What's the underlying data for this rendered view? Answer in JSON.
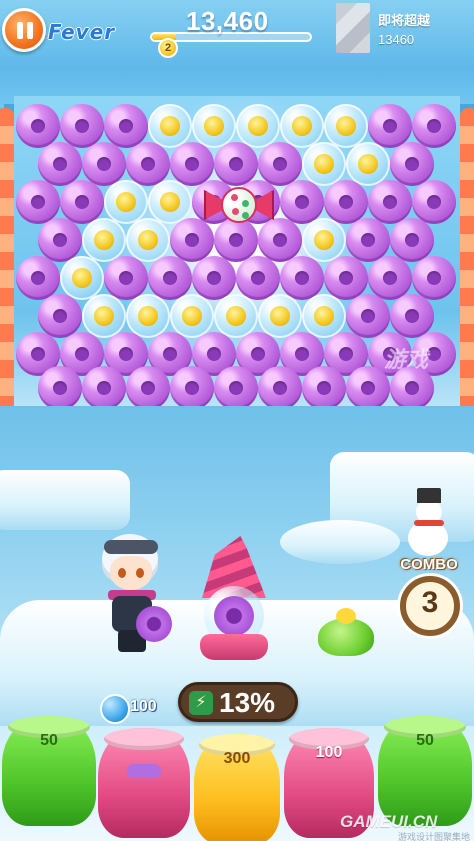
{
  "hud": {
    "fever_label": "Fever",
    "fever_progress": 0.15,
    "score": "13,460",
    "coin_badge": "2",
    "rival_label": "即将超越",
    "rival_score": "13460"
  },
  "board": {
    "bubble_colors": {
      "purple": "#b35bd9",
      "coin": "#f2c316"
    },
    "special_item": "candy-icon"
  },
  "combo": {
    "label": "COMBO",
    "count": "3"
  },
  "shooter": {
    "next_value": "100",
    "progress_percent": "13%",
    "progress_icon": "lightning-icon"
  },
  "pots": [
    {
      "value": "50",
      "color": "green"
    },
    {
      "value": "",
      "color": "pink"
    },
    {
      "value": "300",
      "color": "yellow"
    },
    {
      "value": "100",
      "color": "pink"
    },
    {
      "value": "50",
      "color": "green"
    }
  ],
  "watermark": {
    "side_text": "游戏",
    "brand": "GAMEUI.CN",
    "sub": "游戏设计图聚集地"
  }
}
